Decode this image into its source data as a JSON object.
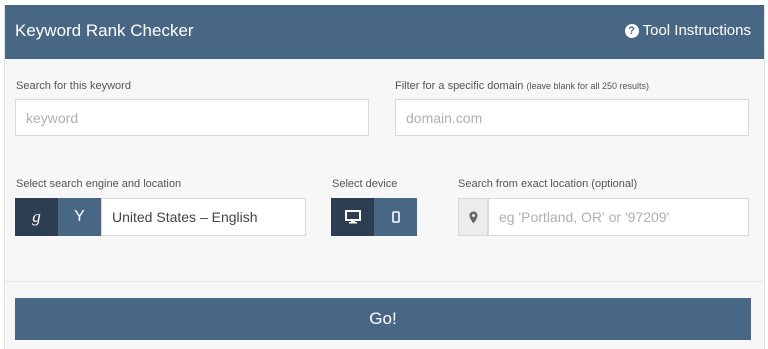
{
  "header": {
    "title": "Keyword Rank Checker",
    "help_label": "Tool Instructions",
    "help_icon": "question-circle-icon"
  },
  "keyword": {
    "label": "Search for this keyword",
    "placeholder": "keyword"
  },
  "domain": {
    "label": "Filter for a specific domain",
    "note": "(leave blank for all 250 results)",
    "placeholder": "domain.com"
  },
  "engine": {
    "label": "Select search engine and location",
    "google_glyph": "g",
    "yahoo_glyph": "Y",
    "selected": "United States – English"
  },
  "device": {
    "label": "Select device",
    "desktop_icon": "desktop-icon",
    "mobile_icon": "mobile-icon"
  },
  "location": {
    "label": "Search from exact location (optional)",
    "placeholder": "eg 'Portland, OR' or '97209'",
    "icon": "map-pin-icon"
  },
  "submit": {
    "label": "Go!"
  },
  "colors": {
    "header": "#486785",
    "dark": "#2c3e50",
    "panel": "#f7f7f7"
  }
}
